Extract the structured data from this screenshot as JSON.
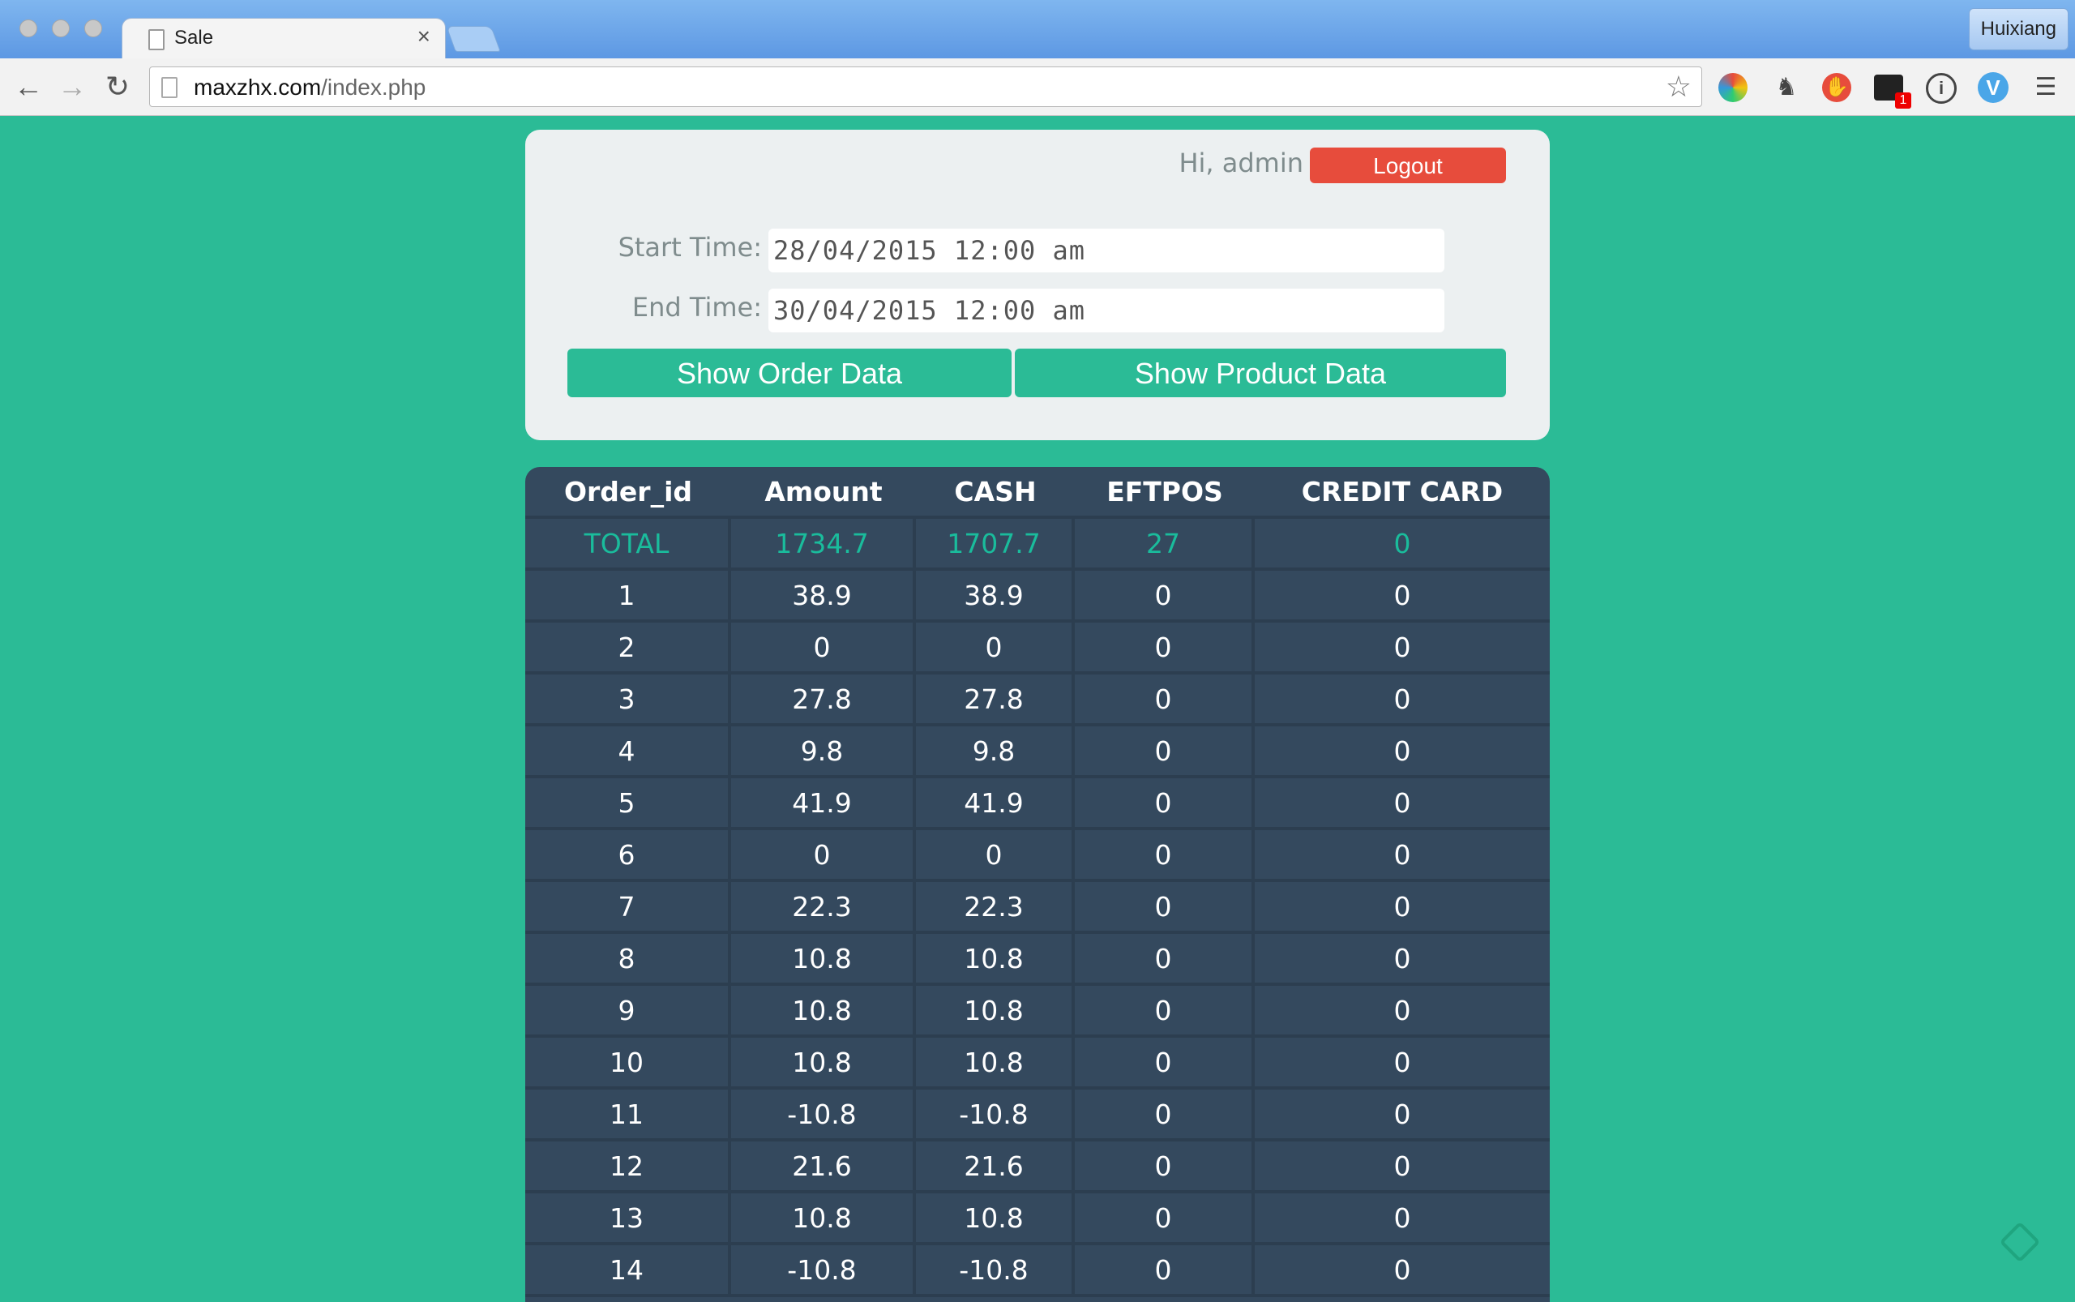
{
  "browser": {
    "tab_title": "Sale",
    "tab_close": "×",
    "profile_name": "Huixiang",
    "url_host": "maxzhx.com",
    "url_path": "/index.php",
    "extension_badge": "1"
  },
  "header": {
    "greeting": "Hi, admin",
    "logout_label": "Logout"
  },
  "filters": {
    "start_label": "Start Time:",
    "start_value": "28/04/2015 12:00 am",
    "end_label": "End Time:",
    "end_value": "30/04/2015 12:00 am",
    "show_order_label": "Show Order Data",
    "show_product_label": "Show Product Data"
  },
  "table": {
    "columns": [
      "Order_id",
      "Amount",
      "CASH",
      "EFTPOS",
      "CREDIT CARD"
    ],
    "rows": [
      [
        "TOTAL",
        "1734.7",
        "1707.7",
        "27",
        "0"
      ],
      [
        "1",
        "38.9",
        "38.9",
        "0",
        "0"
      ],
      [
        "2",
        "0",
        "0",
        "0",
        "0"
      ],
      [
        "3",
        "27.8",
        "27.8",
        "0",
        "0"
      ],
      [
        "4",
        "9.8",
        "9.8",
        "0",
        "0"
      ],
      [
        "5",
        "41.9",
        "41.9",
        "0",
        "0"
      ],
      [
        "6",
        "0",
        "0",
        "0",
        "0"
      ],
      [
        "7",
        "22.3",
        "22.3",
        "0",
        "0"
      ],
      [
        "8",
        "10.8",
        "10.8",
        "0",
        "0"
      ],
      [
        "9",
        "10.8",
        "10.8",
        "0",
        "0"
      ],
      [
        "10",
        "10.8",
        "10.8",
        "0",
        "0"
      ],
      [
        "11",
        "-10.8",
        "-10.8",
        "0",
        "0"
      ],
      [
        "12",
        "21.6",
        "21.6",
        "0",
        "0"
      ],
      [
        "13",
        "10.8",
        "10.8",
        "0",
        "0"
      ],
      [
        "14",
        "-10.8",
        "-10.8",
        "0",
        "0"
      ]
    ]
  },
  "colors": {
    "page_background": "#2bbb96",
    "table_background": "#34495e",
    "total_row_text": "#1abc9c",
    "logout_button": "#e74c3c"
  }
}
